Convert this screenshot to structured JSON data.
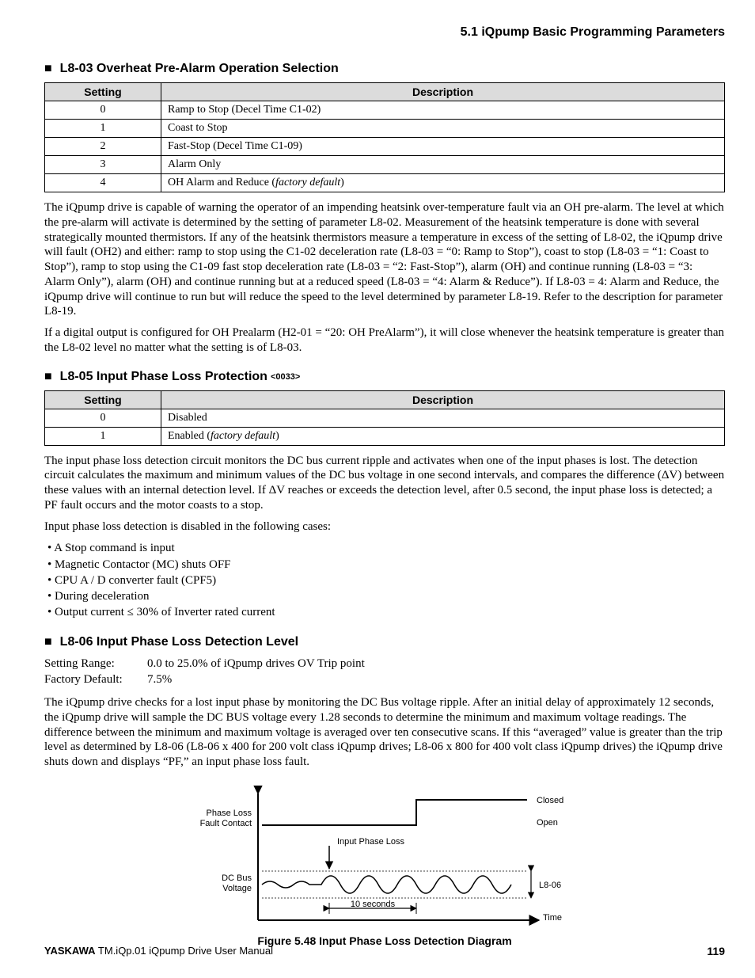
{
  "header": {
    "section": "5.1  iQpump Basic Programming Parameters"
  },
  "sec1": {
    "title": "L8-03 Overheat Pre-Alarm Operation Selection",
    "table": {
      "headers": [
        "Setting",
        "Description"
      ],
      "rows": [
        {
          "s": "0",
          "d": "Ramp to Stop (Decel Time C1-02)"
        },
        {
          "s": "1",
          "d": "Coast to Stop"
        },
        {
          "s": "2",
          "d": "Fast-Stop (Decel Time C1-09)"
        },
        {
          "s": "3",
          "d": "Alarm Only"
        },
        {
          "s": "4",
          "d_pre": "OH Alarm and Reduce (",
          "d_em": "factory default",
          "d_post": ")"
        }
      ]
    },
    "p1": "The iQpump drive is capable of warning the operator of an impending heatsink over-temperature fault via an OH pre-alarm. The level at which the pre-alarm will activate is determined by the setting of parameter L8-02. Measurement of the heatsink temperature is done with several strategically mounted thermistors. If any of the heatsink thermistors measure a temperature in excess of the setting of L8-02, the iQpump drive will fault (OH2) and either: ramp to stop using the C1-02 deceleration rate (L8-03 = “0: Ramp to Stop”), coast to stop (L8-03 = “1: Coast to Stop”), ramp to stop using the C1-09 fast stop deceleration rate (L8-03 = “2: Fast-Stop”), alarm (OH) and continue running (L8-03 = “3: Alarm Only”), alarm (OH) and continue running but at a reduced speed (L8-03 = “4: Alarm & Reduce”). If L8-03 = 4: Alarm and Reduce, the iQpump drive will continue to run but will reduce the speed to the level determined by parameter L8-19. Refer to the description for parameter L8-19.",
    "p2": "If a digital output is configured for OH Prealarm (H2-01 = “20: OH PreAlarm”), it will close whenever the heatsink temperature is greater than the L8-02 level no matter what the setting is of L8-03."
  },
  "sec2": {
    "title": "L8-05 Input Phase Loss Protection ",
    "tag": "<0033>",
    "table": {
      "headers": [
        "Setting",
        "Description"
      ],
      "rows": [
        {
          "s": "0",
          "d": "Disabled"
        },
        {
          "s": "1",
          "d_pre": "Enabled (",
          "d_em": "factory default",
          "d_post": ")"
        }
      ]
    },
    "p1": "The input phase loss detection circuit monitors the DC bus current ripple and activates when one of the input phases is lost. The detection circuit calculates the maximum and minimum values of the DC bus voltage in one second intervals, and compares the difference (ΔV) between these values with an internal detection level. If ΔV reaches or exceeds the detection level, after 0.5 second, the input phase loss is detected; a PF fault occurs and the motor coasts to a stop.",
    "p2": "Input phase loss detection is disabled in the following cases:",
    "bullets": [
      "A Stop command is input",
      "Magnetic Contactor (MC) shuts OFF",
      "CPU A / D converter fault (CPF5)",
      "During deceleration",
      "Output current ≤ 30% of Inverter rated current"
    ]
  },
  "sec3": {
    "title": "L8-06 Input Phase Loss Detection Level",
    "range_label": "Setting Range:",
    "range_value": "0.0 to 25.0% of iQpump drives OV Trip point",
    "default_label": "Factory Default:",
    "default_value": "7.5%",
    "p1": "The iQpump drive checks for a lost input phase by monitoring the DC Bus voltage ripple. After an initial delay of approximately 12 seconds, the iQpump drive will sample the DC BUS voltage every 1.28 seconds to determine the minimum and maximum voltage readings. The difference between the minimum and maximum voltage is averaged over ten consecutive scans. If this “averaged” value is greater than the trip level as determined by L8-06 (L8-06 x 400 for 200 volt class iQpump drives; L8-06 x 800 for 400 volt class iQpump drives) the iQpump drive shuts down and displays “PF,” an input phase loss fault."
  },
  "figure": {
    "caption": "Figure 5.48  Input Phase Loss Detection Diagram",
    "labels": {
      "pl": "Phase Loss",
      "fc": "Fault Contact",
      "closed": "Closed",
      "open": "Open",
      "ipl": "Input Phase Loss",
      "dcbus": "DC Bus",
      "volt": "Voltage",
      "tensec": "10 seconds",
      "time": "Time",
      "l806": "L8-06"
    }
  },
  "footer": {
    "brand": "YASKAWA",
    "doc": " TM.iQp.01 iQpump Drive User Manual",
    "page": "119"
  },
  "chart_data": {
    "type": "line",
    "title": "Input Phase Loss Detection Diagram",
    "xlabel": "Time",
    "series": [
      {
        "name": "Phase Loss Fault Contact",
        "type": "step",
        "states": [
          "Open",
          "Closed"
        ],
        "values": [
          [
            "0",
            "Open"
          ],
          [
            "t_ipl+10s",
            "Open"
          ],
          [
            "t_ipl+10s",
            "Closed"
          ],
          [
            "end",
            "Closed"
          ]
        ]
      },
      {
        "name": "DC Bus Voltage",
        "type": "ripple",
        "ripple_amplitude_before": "< L8-06",
        "ripple_amplitude_after": "≈ L8-06",
        "event": "Input Phase Loss at t_ipl",
        "detection_delay": "10 seconds"
      }
    ],
    "annotations": [
      "Input Phase Loss",
      "10 seconds",
      "L8-06"
    ]
  }
}
